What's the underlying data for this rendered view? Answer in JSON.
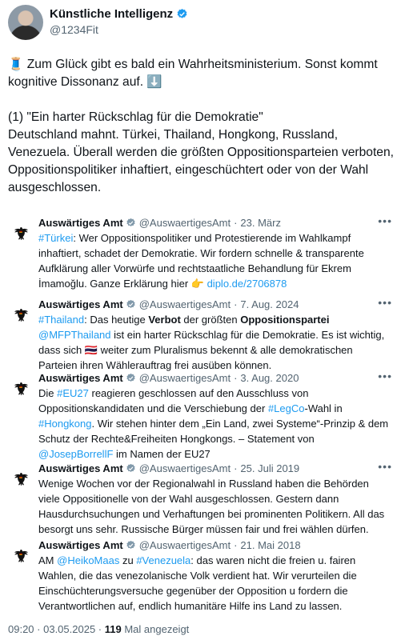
{
  "author": {
    "name": "Künstliche Intelligenz",
    "handle": "@1234Fit"
  },
  "post": {
    "emoji_lead": "🧵",
    "intro": " Zum Glück gibt es bald ein Wahrheitsministerium. Sonst kommt kognitive Dissonanz auf. ",
    "emoji_down": "⬇️",
    "heading": "(1) \"Ein harter Rückschlag für die Demokratie\"",
    "body": "Deutschland mahnt. Türkei, Thailand, Hongkong, Russland, Venezuela. Überall werden die größten Oppositionsparteien verboten, Oppositionspolitiker inhaftiert, eingeschüchtert oder von der Wahl ausgeschlossen."
  },
  "quotes": [
    {
      "name": "Auswärtiges Amt",
      "handle": "@AuswaertigesAmt",
      "date": "23. März",
      "text": {
        "tag": "#Türkei",
        "rest": ": Wer Oppositionspolitiker und Protestierende im Wahlkampf inhaftiert, schadet der Demokratie. Wir fordern schnelle & transparente Aufklärung aller Vorwürfe und rechtstaatliche Behandlung für Ekrem İmamoğlu. Ganze Erklärung hier ",
        "emoji": "👉",
        "link": "diplo.de/2706878"
      }
    },
    {
      "name": "Auswärtiges Amt",
      "handle": "@AuswaertigesAmt",
      "date": "7. Aug. 2024",
      "text": {
        "tag": "#Thailand",
        "p1": ": Das heutige ",
        "b1": "Verbot",
        "p2": " der größten ",
        "b2": "Oppositionspartei",
        "mention": "@MFPThailand",
        "p3": " ist ein harter Rückschlag für die Demokratie. Es ist wichtig, dass sich ",
        "flag": "🇹🇭",
        "p4": " weiter zum Pluralismus bekennt & alle demokratischen Parteien ihren Wählerauftrag frei ausüben können."
      }
    },
    {
      "name": "Auswärtiges Amt",
      "handle": "@AuswaertigesAmt",
      "date": "3. Aug. 2020",
      "text": {
        "p0": "Die ",
        "tag1": "#EU27",
        "p1": " reagieren geschlossen auf den Ausschluss von Oppositionskandidaten und die Verschiebung der ",
        "tag2": "#LegCo",
        "p2": "-Wahl in ",
        "tag3": "#Hongkong",
        "p3": ". Wir stehen hinter dem „Ein Land, zwei Systeme“-Prinzip & dem Schutz der Rechte&Freiheiten Hongkongs. – Statement von ",
        "mention": "@JosepBorrellF",
        "p4": " im Namen der EU27"
      }
    },
    {
      "name": "Auswärtiges Amt",
      "handle": "@AuswaertigesAmt",
      "date": "25. Juli 2019",
      "text": {
        "p0": "Wenige Wochen vor der Regionalwahl in Russland haben die Behörden viele Oppositionelle von der Wahl ausgeschlossen. Gestern dann Hausdurchsuchungen und Verhaftungen bei prominenten Politikern. All das besorgt uns sehr. Russische Bürger müssen fair und frei wählen dürfen."
      }
    },
    {
      "name": "Auswärtiges Amt",
      "handle": "@AuswaertigesAmt",
      "date": "21. Mai 2018",
      "text": {
        "p0": "AM ",
        "mention": "@HeikoMaas",
        "p1": " zu ",
        "tag": "#Venezuela",
        "p2": ": das waren nicht die freien u. fairen Wahlen, die das venezolanische Volk verdient hat. Wir verurteilen die Einschüchterungsversuche gegenüber der Opposition u fordern die Verantwortlichen auf, endlich humanitäre Hilfe ins Land zu lassen."
      }
    }
  ],
  "footer": {
    "time": "09:20",
    "sep": " · ",
    "date": "03.05.2025",
    "views": "119",
    "views_label": " Mal angezeigt"
  },
  "icons": {
    "verified": "verified-badge-icon",
    "more": "more-options-icon",
    "logo": "federal-eagle-icon"
  },
  "colors": {
    "link": "#1d9bf0",
    "text": "#0f1419",
    "muted": "#536471"
  }
}
